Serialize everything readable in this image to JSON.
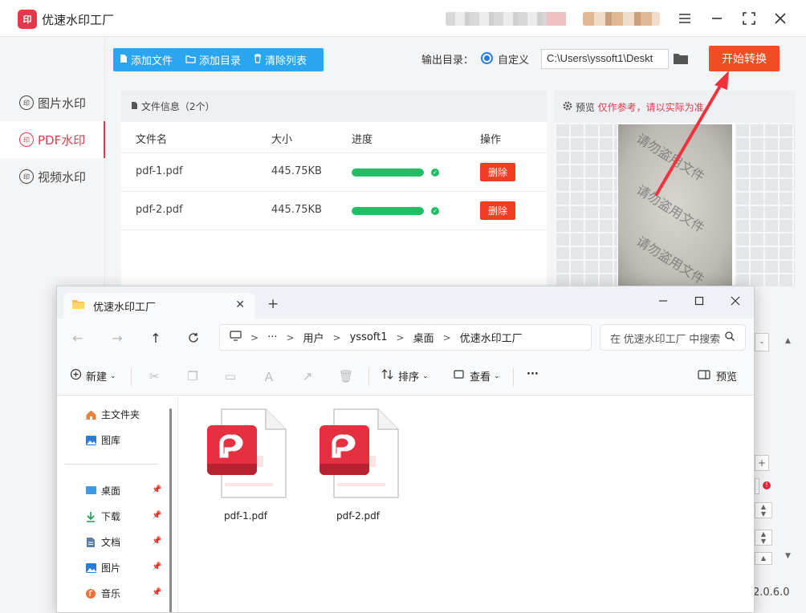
{
  "app": {
    "title": "优速水印工厂",
    "logo_text": "印",
    "version": "2.0.6.0",
    "sidebar": [
      {
        "label": "图片水印",
        "active": false
      },
      {
        "label": "PDF水印",
        "active": true
      },
      {
        "label": "视频水印",
        "active": false
      }
    ],
    "toolbar": {
      "add_file": "添加文件",
      "add_folder": "添加目录",
      "clear_list": "清除列表"
    },
    "output": {
      "label": "输出目录：",
      "radio_label": "自定义",
      "path": "C:\\Users\\yssoft1\\Deskt"
    },
    "start_button": "开始转换",
    "file_panel": {
      "header": "文件信息（2个）",
      "columns": [
        "文件名",
        "大小",
        "进度",
        "操作"
      ],
      "rows": [
        {
          "name": "pdf-1.pdf",
          "size": "445.75KB",
          "progress": 1.0,
          "action": "删除"
        },
        {
          "name": "pdf-2.pdf",
          "size": "445.75KB",
          "progress": 1.0,
          "action": "删除"
        }
      ]
    },
    "preview": {
      "label": "预览",
      "warning": "仅作参考，请以实际为准",
      "watermark_text": "请勿盗用文件"
    },
    "colors": {
      "accent_red": "#e0394c",
      "start_orange": "#ef4e23",
      "toolbar_blue": "#2aa6f0",
      "progress_green": "#1fbf66",
      "arrow_red": "#f0323c"
    }
  },
  "explorer": {
    "tab_title": "优速水印工厂",
    "breadcrumb": [
      "用户",
      "yssoft1",
      "桌面",
      "优速水印工厂"
    ],
    "more_crumb": "···",
    "search_placeholder": "在 优速水印工厂 中搜索",
    "commands": {
      "new": "新建",
      "sort": "排序",
      "view": "查看",
      "more": "···",
      "preview": "预览"
    },
    "nav": [
      {
        "label": "主文件夹",
        "icon": "home-icon",
        "pinned": false
      },
      {
        "label": "图库",
        "icon": "gallery-icon",
        "pinned": false
      },
      {
        "label": "桌面",
        "icon": "desktop-icon",
        "pinned": true
      },
      {
        "label": "下载",
        "icon": "download-icon",
        "pinned": true
      },
      {
        "label": "文档",
        "icon": "document-icon",
        "pinned": true
      },
      {
        "label": "图片",
        "icon": "picture-icon",
        "pinned": true
      },
      {
        "label": "音乐",
        "icon": "music-icon",
        "pinned": true
      }
    ],
    "files": [
      {
        "name": "pdf-1.pdf",
        "icon": "pdf-file-icon"
      },
      {
        "name": "pdf-2.pdf",
        "icon": "pdf-file-icon"
      }
    ]
  }
}
